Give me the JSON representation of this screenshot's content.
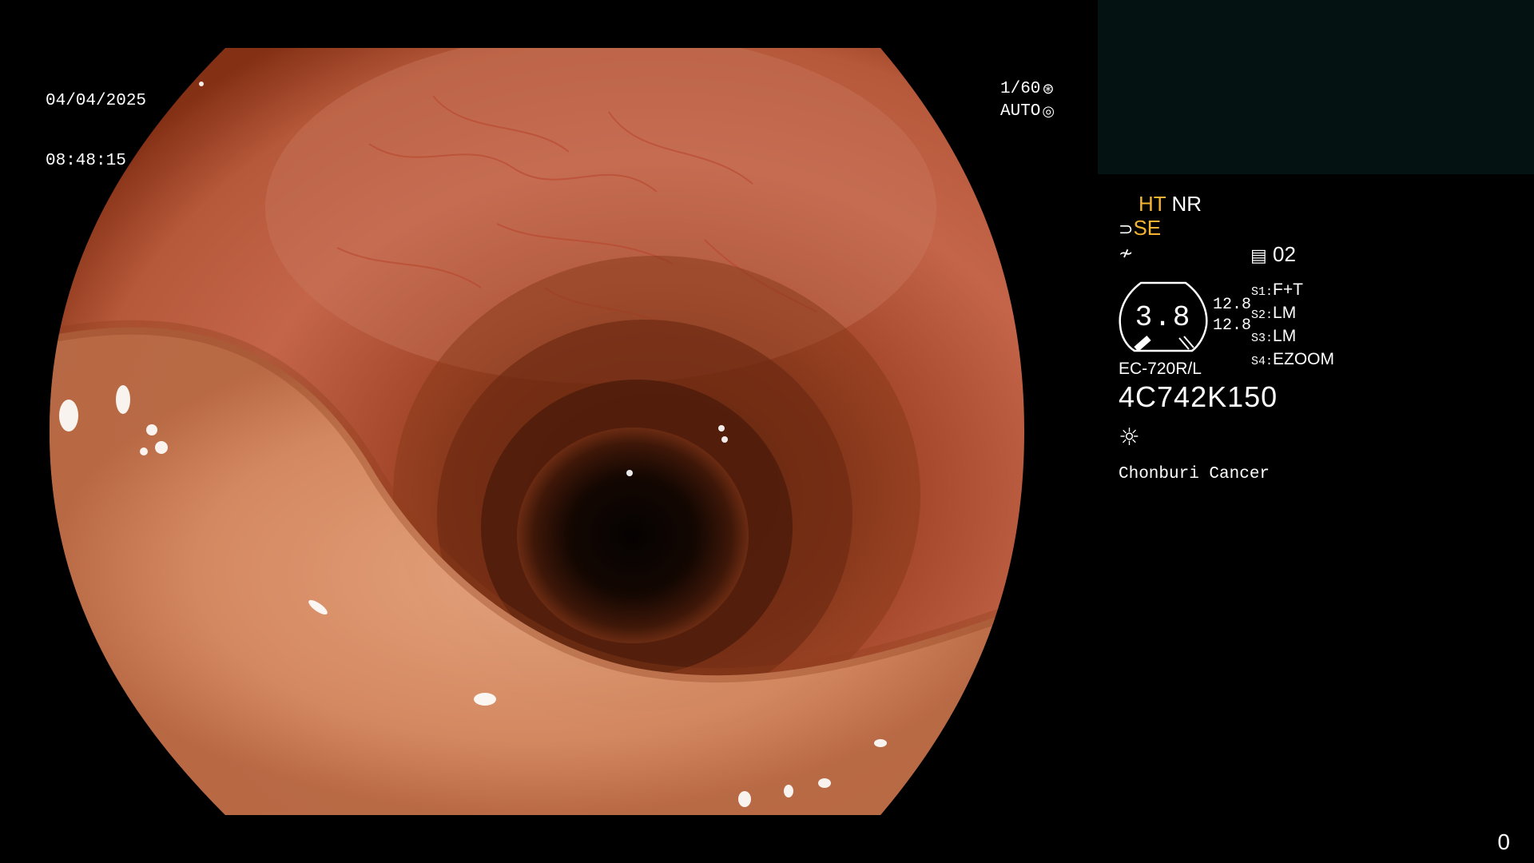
{
  "overlay": {
    "date": "04/04/2025",
    "time": "08:48:15",
    "shutter": "1/60",
    "iris": "AUTO"
  },
  "info": {
    "mode_ht": "HT",
    "mode_nr": "NR",
    "mode_se": "SE",
    "memory": "02",
    "gauge_value": "3.8",
    "left_value_1": "12.8",
    "left_value_2": "12.8",
    "switches": [
      {
        "key": "S1:",
        "value": "F+T"
      },
      {
        "key": "S2:",
        "value": "LM"
      },
      {
        "key": "S3:",
        "value": "LM"
      },
      {
        "key": "S4:",
        "value": "EZOOM"
      }
    ],
    "scope_model": "EC-720R/L",
    "scope_serial": "4C742K150",
    "hospital": "Chonburi Cancer"
  },
  "footer": {
    "counter": "0"
  },
  "colors": {
    "accent": "#f4b431",
    "thumbnail_bg": "#041311"
  },
  "icons": [
    "shutter-icon",
    "iris-icon",
    "hand-icon",
    "curve-icon",
    "memory-icon",
    "lamp-icon"
  ]
}
